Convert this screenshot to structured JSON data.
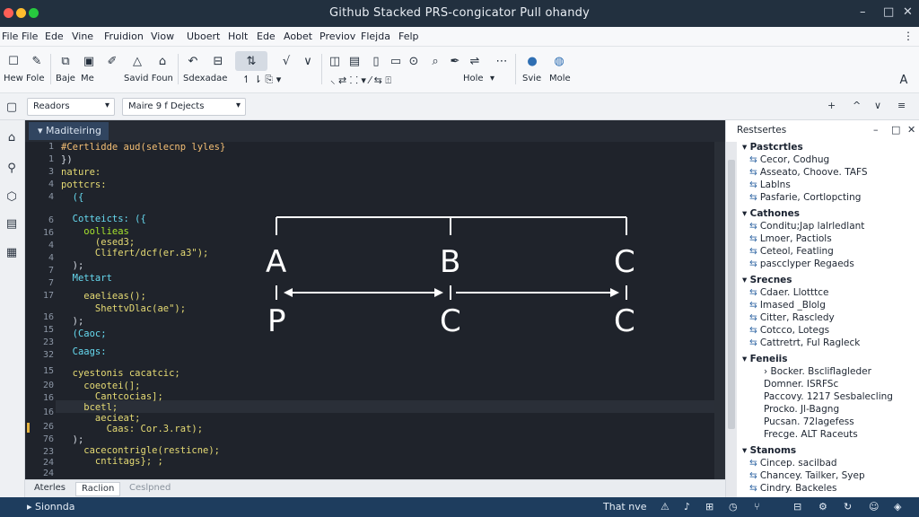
{
  "window": {
    "title": "Github Stacked PRS-congicator Pull ohandy",
    "controls": [
      "–",
      "□",
      "✕"
    ]
  },
  "menu": [
    "File",
    "File",
    "Ede",
    "Vine",
    "Fruidion",
    "Viow",
    "Uboert",
    "Holt",
    "Ede",
    "Aobet",
    "Previov",
    "Flejda",
    "Felp"
  ],
  "toolbar": {
    "labels": [
      "Hew Fole",
      "Baje",
      "Me",
      "Savid Foun",
      "Sdexadae",
      "Hole",
      "Svie",
      "Mole"
    ],
    "icons": [
      "new-file-icon",
      "pencil-icon",
      "copy-icon",
      "paste-icon",
      "brush-icon",
      "triangle-icon",
      "lock-icon",
      "undo-icon",
      "box-icon",
      "filter-icon",
      "check-icon",
      "chevron-icon",
      "comment-icon",
      "document-icon",
      "page-icon",
      "target-icon",
      "search-icon",
      "pen-icon",
      "split-icon",
      "more-icon",
      "user-icon",
      "globe-icon"
    ]
  },
  "subbar": {
    "dropdown1": "Readors",
    "dropdown2": "Maire 9 f Dejects",
    "controls": [
      "+",
      "^",
      "∨",
      "≡"
    ]
  },
  "editor": {
    "tab": "Maditeiring",
    "line_numbers": [
      "1",
      "1",
      "3",
      "4",
      "4",
      "6",
      "16",
      "4",
      "4",
      "7",
      "7",
      "17",
      "16",
      "15",
      "23",
      "32",
      "15",
      "20",
      "16",
      "16",
      "26",
      "76",
      "23",
      "24",
      "24",
      "26",
      "36"
    ],
    "lines": [
      "#Certlidde aud(selecnp lyles}",
      "})",
      "nature:",
      "pottcrs:",
      "  ({",
      "",
      "  Cotteicts: ({",
      "    oollieas",
      "      (esed3;",
      "      Clifert/dcf(er.a3\");",
      "  );",
      "  Mettart",
      "",
      "    eaelieas();",
      "      ShettvDlac(ae\");",
      "  );",
      "  (Caoc;",
      "",
      "  Caags:",
      "",
      "  cyestonis cacatcic;",
      "    coeotei(];",
      "      Cantcocias];",
      "    bcetl;",
      "      aecieat;",
      "        Caas: Cor.3.rat);",
      "  );",
      "    cacecontrigle(resticne);",
      "      cntitags}; ;"
    ]
  },
  "diagram": {
    "top_letters": [
      "A",
      "B",
      "C"
    ],
    "bottom_letters": [
      "P",
      "C",
      "C"
    ]
  },
  "panel_tabs": [
    "Aterles",
    "Raclion",
    "Ceslpned"
  ],
  "right_panel": {
    "title": "Restsertes",
    "controls": [
      "–",
      "□",
      "✕"
    ],
    "sections": [
      {
        "title": "Pastcrtles",
        "items": [
          "Cecor, Codhug",
          "Asseato, Choove. TAFS",
          "Lablns",
          "Pasfarie, Cortlopcting"
        ],
        "sub": false
      },
      {
        "title": "Cathones",
        "items": [
          "Conditu;Jap lalrledlant",
          "Lmoer, Pactiols",
          "Ceteol, Featling",
          "pascclyper Regaeds"
        ],
        "sub": false
      },
      {
        "title": "Srecnes",
        "items": [
          "Cdaer. Llotttce",
          "Imased _Blolg",
          "Citter, Rascledy",
          "Cotcco, Lotegs",
          "Cattretrt, Ful Ragleck"
        ],
        "sub": false
      },
      {
        "title": "Feneiis",
        "items": [
          "Bocker. Bscliflagleder",
          "Domner. ISRFSc",
          "Paccovy. 1217 Sesbalecling",
          "Procko. Jl-Bagng",
          "Pucsan. 72lagefess",
          "Frecge. ALT Raceuts"
        ],
        "sub": true
      },
      {
        "title": "Stanoms",
        "items": [
          "Cincep. sacilbad",
          "Chancey. Tailker, Syep",
          "Cindry. Backeles"
        ],
        "sub": false
      }
    ]
  },
  "status": {
    "left": "Sionnda",
    "center": "That nve",
    "icons": [
      "warning-icon",
      "bell-icon",
      "chevron-icon",
      "clock-icon",
      "branch-icon",
      "lock-icon",
      "settings-icon",
      "user-icon"
    ]
  }
}
